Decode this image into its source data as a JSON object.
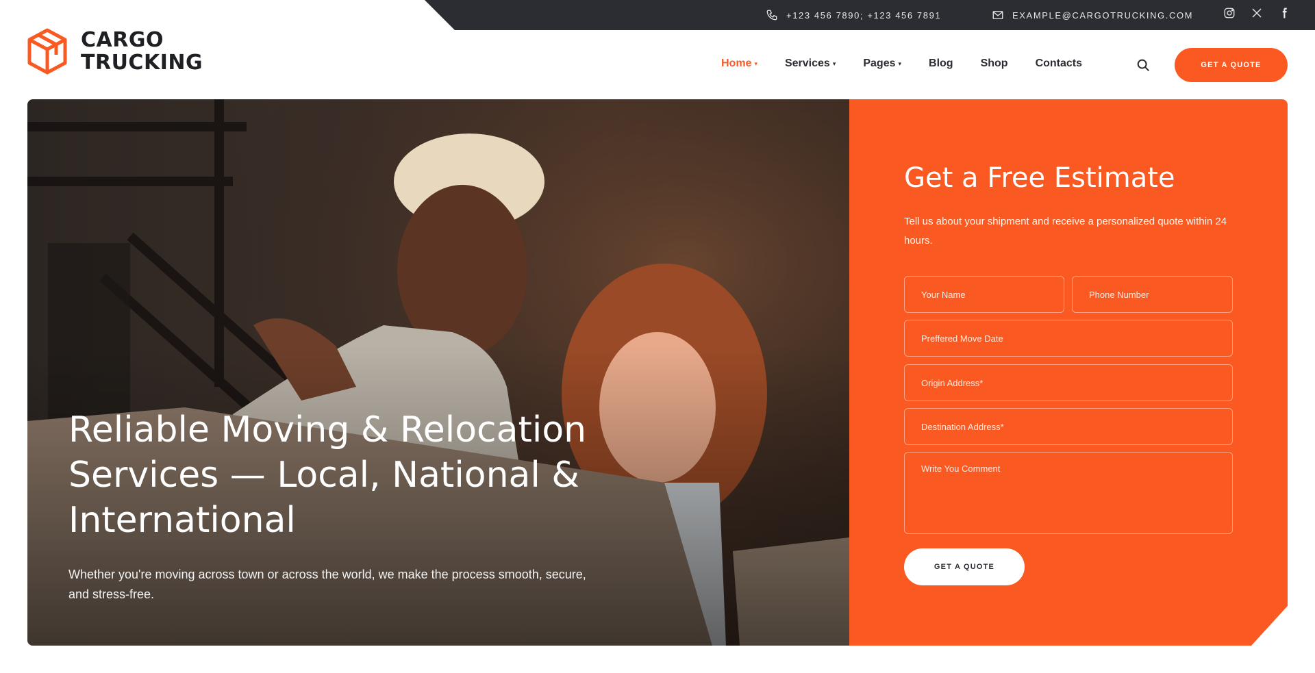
{
  "topbar": {
    "phones": "+123 456 7890; +123 456 7891",
    "email": "EXAMPLE@CARGOTRUCKING.COM",
    "icons": [
      "phone-icon",
      "envelope-icon",
      "instagram-icon",
      "x-icon",
      "facebook-icon"
    ]
  },
  "logo": {
    "line1": "CARGO",
    "line2": "TRUCKING",
    "icon": "box-icon"
  },
  "nav": {
    "items": [
      {
        "label": "Home",
        "dropdown": true,
        "active": true
      },
      {
        "label": "Services",
        "dropdown": true
      },
      {
        "label": "Pages",
        "dropdown": true
      },
      {
        "label": "Blog"
      },
      {
        "label": "Shop"
      },
      {
        "label": "Contacts"
      }
    ],
    "search_icon": "search-icon",
    "cta": "GET A QUOTE"
  },
  "hero": {
    "title": "Reliable Moving & Relocation Services — Local, National & International",
    "subtitle": "Whether you're moving across town or across the world, we make the process smooth, secure, and stress-free."
  },
  "estimate": {
    "title": "Get a Free Estimate",
    "subtitle": "Tell us about your shipment and receive a personalized quote within 24 hours.",
    "fields": {
      "name": "Your Name",
      "phone": "Phone Number",
      "date": "Preffered Move Date",
      "origin": "Origin Address*",
      "destination": "Destination Address*",
      "comment": "Write You Comment"
    },
    "submit": "GET A QUOTE"
  },
  "colors": {
    "accent": "#fa5a22",
    "dark": "#2b2d33",
    "white": "#ffffff"
  }
}
